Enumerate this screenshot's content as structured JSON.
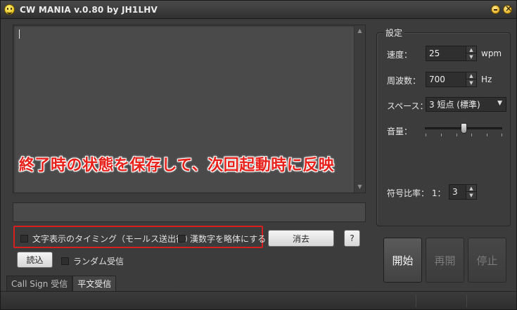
{
  "window": {
    "title": "CW MANIA v.0.80 by JH1LHV"
  },
  "options": {
    "show_timing_label": "文字表示のタイミング（モールス送出後）",
    "simplified_kanji_label": "漢数字を略体にする",
    "clear_label": "消去",
    "help_label": "?",
    "load_label": "読込",
    "random_receive_label": "ランダム受信"
  },
  "tabs": [
    {
      "label": "Call Sign 受信",
      "active": false
    },
    {
      "label": "平文受信",
      "active": true
    }
  ],
  "settings": {
    "title": "設定",
    "speed_label": "速度：",
    "speed_value": "25",
    "speed_unit": "wpm",
    "frequency_label": "周波数：",
    "frequency_value": "700",
    "frequency_unit": "Hz",
    "space_label": "スペース：",
    "space_value": "3 短点 (標準)",
    "volume_label": "音量：",
    "volume_level": 0.5,
    "ratio_label": "符号比率： 1：",
    "ratio_value": "3"
  },
  "controls": {
    "start_label": "開始",
    "resume_label": "再開",
    "stop_label": "停止"
  },
  "annotation": {
    "caption": "終了時の状態を保存して、次回起動時に反映"
  },
  "colors": {
    "annotation_red": "#d81f1f"
  }
}
